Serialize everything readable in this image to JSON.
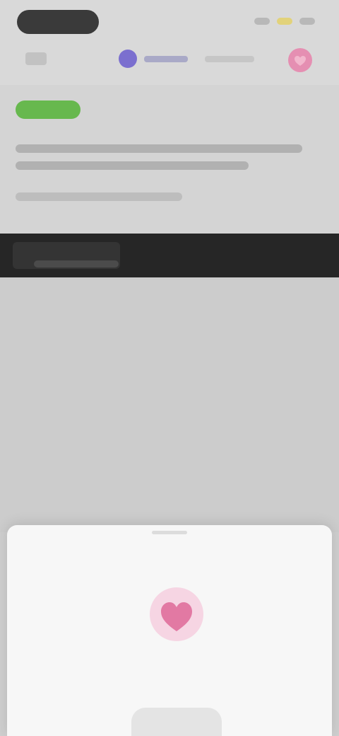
{
  "colors": {
    "accent_purple": "#7b6fcf",
    "favorite_pink": "#e58fb2",
    "badge_green": "#67b84e",
    "banner_dark": "#262626",
    "heart_pink": "#e279a3"
  },
  "icons": {
    "back": "back-pill-icon",
    "brand": "brand-icon",
    "favorite": "heart-icon",
    "sheet_illustration": "heart-icon"
  },
  "topbar": {},
  "summary": {},
  "banner": {},
  "sheet": {
    "title": "",
    "body": "",
    "action_label": ""
  }
}
